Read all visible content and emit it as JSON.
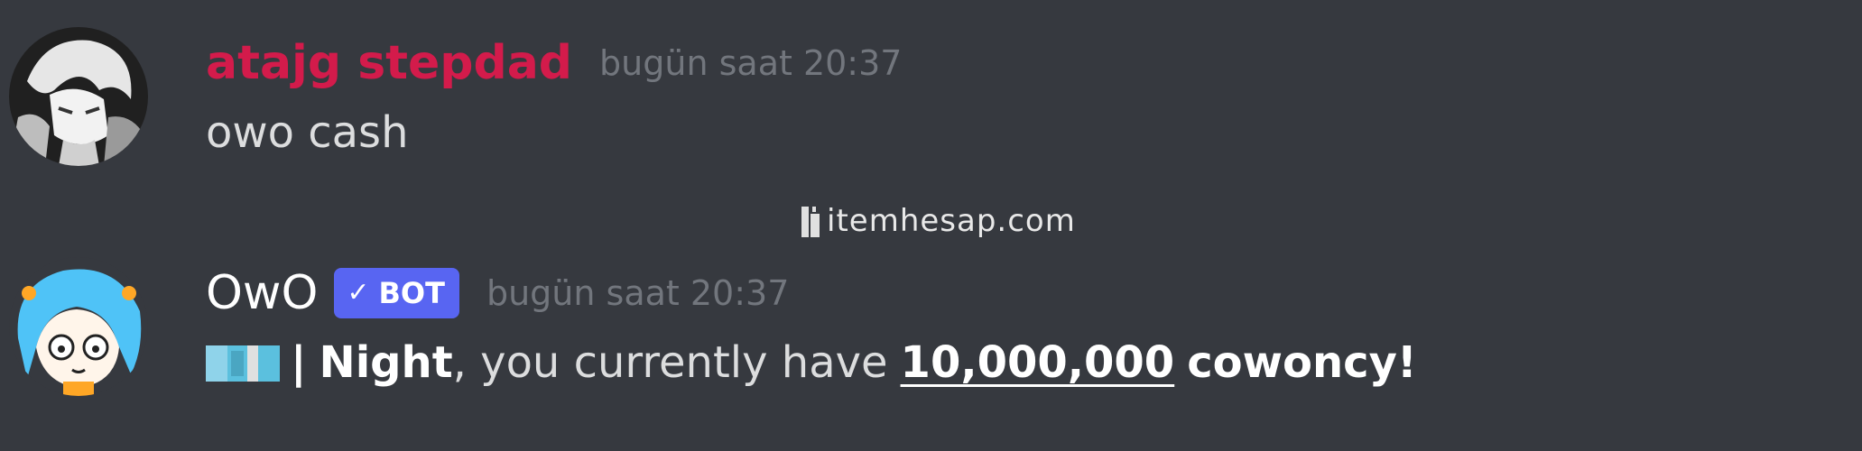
{
  "messages": [
    {
      "author": "atajg stepdad",
      "author_color": "#d31b4b",
      "timestamp": "bugün saat 20:37",
      "text": "owo cash"
    },
    {
      "author": "OwO",
      "author_color": "#ffffff",
      "badge": {
        "check": "✓",
        "label": "BOT",
        "color": "#5865f2"
      },
      "timestamp": "bugün saat 20:37",
      "emoji": "cowoncy-icon",
      "pipe": "|",
      "name": "Night",
      "text_middle": ", you currently have",
      "amount": "10,000,000",
      "currency": "cowoncy!"
    }
  ],
  "watermark": "itemhesap.com",
  "colors": {
    "background": "#36393f",
    "timestamp": "#72767d",
    "text": "#dcddde"
  }
}
